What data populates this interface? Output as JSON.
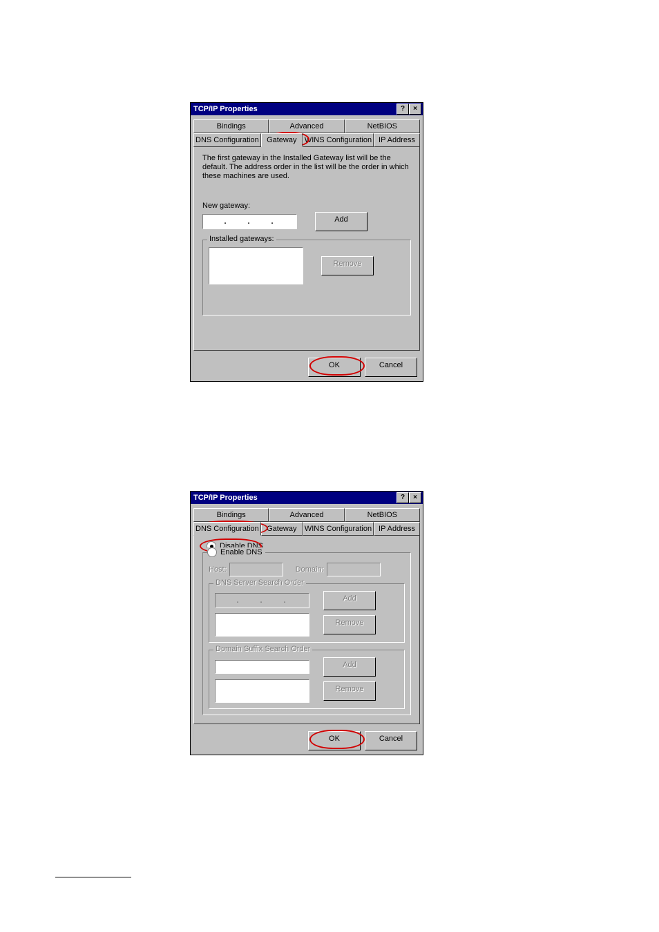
{
  "dialog1": {
    "title": "TCP/IP Properties",
    "tabs_back": [
      "Bindings",
      "Advanced",
      "NetBIOS"
    ],
    "tabs_front": [
      "DNS Configuration",
      "Gateway",
      "WINS Configuration",
      "IP Address"
    ],
    "active_tab": "Gateway",
    "helptext": "The first gateway in the Installed Gateway list will be the default. The address order in the list will be the order in which these machines are used.",
    "new_gateway_label": "New gateway:",
    "add_label": "Add",
    "installed_label": "Installed gateways:",
    "remove_label": "Remove",
    "ok_label": "OK",
    "cancel_label": "Cancel"
  },
  "dialog2": {
    "title": "TCP/IP Properties",
    "tabs_back": [
      "Bindings",
      "Advanced",
      "NetBIOS"
    ],
    "tabs_front": [
      "DNS Configuration",
      "Gateway",
      "WINS Configuration",
      "IP Address"
    ],
    "active_tab": "DNS Configuration",
    "disable_label": "Disable DNS",
    "enable_label": "Enable DNS",
    "dns_radio_selected": "disable",
    "host_label": "Host:",
    "domain_label": "Domain:",
    "dns_order_label": "DNS Server Search Order",
    "suffix_order_label": "Domain Suffix Search Order",
    "add_label": "Add",
    "remove_label": "Remove",
    "ok_label": "OK",
    "cancel_label": "Cancel"
  },
  "highlights": {
    "circled_items": [
      "Gateway tab (dialog 1)",
      "OK button (dialog 1)",
      "DNS Configuration tab (dialog 2)",
      "Disable DNS radio (dialog 2)",
      "OK button (dialog 2)"
    ]
  }
}
